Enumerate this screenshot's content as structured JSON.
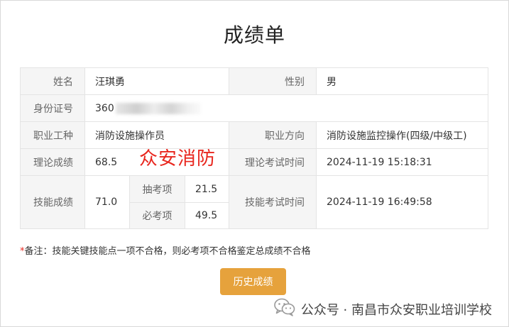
{
  "title": "成绩单",
  "rows": {
    "name_label": "姓名",
    "name_value": "汪琪勇",
    "gender_label": "性别",
    "gender_value": "男",
    "id_label": "身份证号",
    "id_value": "360",
    "job_label": "职业工种",
    "job_value": "消防设施操作员",
    "direction_label": "职业方向",
    "direction_value": "消防设施监控操作(四级/中级工)",
    "theory_label": "理论成绩",
    "theory_value": "68.5",
    "theory_time_label": "理论考试时间",
    "theory_time_value": "2024-11-19 15:18:31",
    "skill_label": "技能成绩",
    "skill_value": "71.0",
    "sample_label": "抽考项",
    "sample_value": "21.5",
    "required_label": "必考项",
    "required_value": "49.5",
    "skill_time_label": "技能考试时间",
    "skill_time_value": "2024-11-19 16:49:58"
  },
  "overlay_text": "众安消防",
  "note": {
    "star": "*",
    "text": "备注：技能关键技能点一项不合格，则必考项不合格鉴定总成绩不合格"
  },
  "history_button": "历史成绩",
  "footer": {
    "text": "公众号 · 南昌市众安职业培训学校",
    "icon": "wechat-icon"
  },
  "colors": {
    "accent_button": "#e6a23c",
    "skill_score": "#3a8ee6",
    "red_text": "#e8261e",
    "label_bg": "#f5f5f5"
  }
}
